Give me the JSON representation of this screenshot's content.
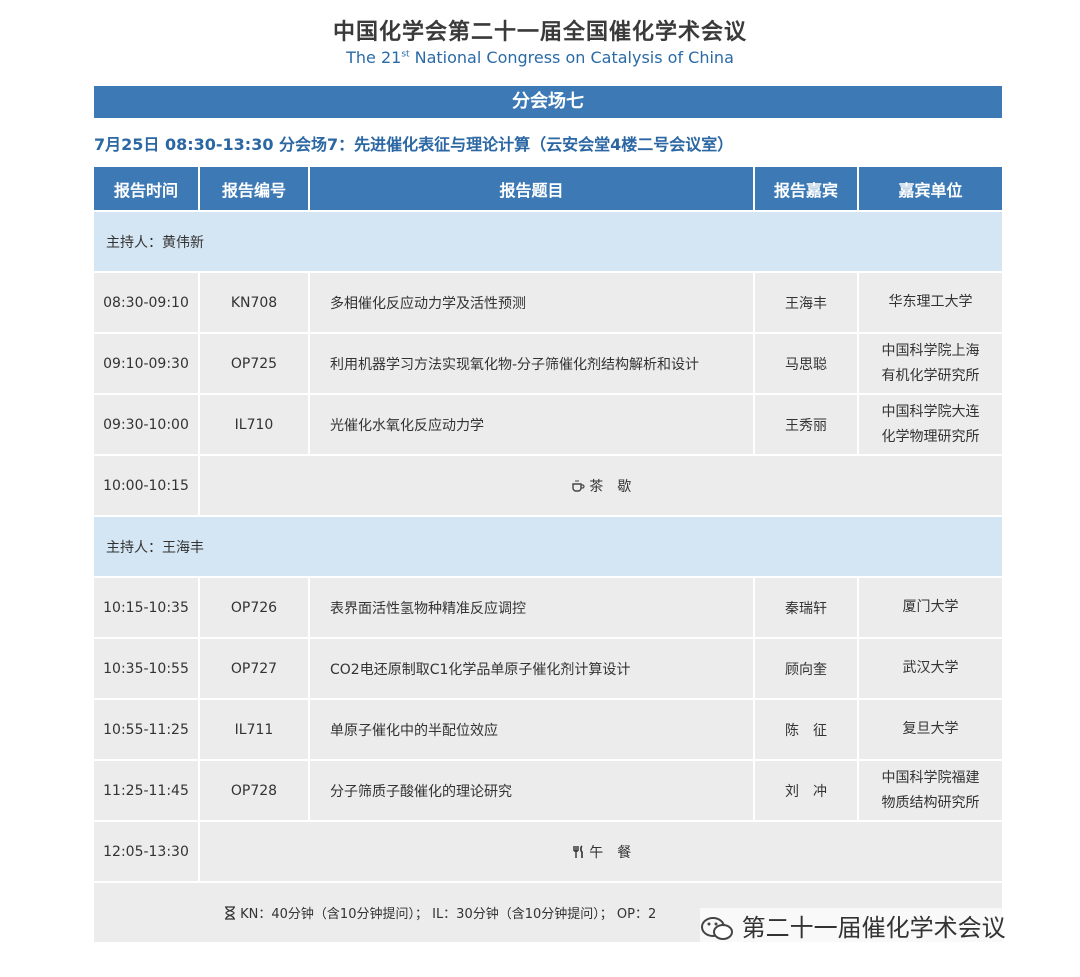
{
  "header": {
    "title_cn": "中国化学会第二十一届全国催化学术会议",
    "title_en_pre": "The 21",
    "title_en_sup": "st",
    "title_en_post": " National Congress on Catalysis of China"
  },
  "banner": "分会场七",
  "session_info": "7月25日 08:30-13:30 分会场7：先进催化表征与理论计算（云安会堂4楼二号会议室）",
  "table": {
    "headers": [
      "报告时间",
      "报告编号",
      "报告题目",
      "报告嘉宾",
      "嘉宾单位"
    ],
    "host1": "主持人：黄伟新",
    "rows1": [
      {
        "time": "08:30-09:10",
        "code": "KN708",
        "topic": "多相催化反应动力学及活性预测",
        "speaker": "王海丰",
        "unit1": "华东理工大学",
        "unit2": ""
      },
      {
        "time": "09:10-09:30",
        "code": "OP725",
        "topic": "利用机器学习方法实现氧化物-分子筛催化剂结构解析和设计",
        "speaker": "马思聪",
        "unit1": "中国科学院上海",
        "unit2": "有机化学研究所"
      },
      {
        "time": "09:30-10:00",
        "code": "IL710",
        "topic": "光催化水氧化反应动力学",
        "speaker": "王秀丽",
        "unit1": "中国科学院大连",
        "unit2": "化学物理研究所"
      }
    ],
    "break": {
      "time": "10:00-10:15",
      "label": "茶　歇"
    },
    "host2": "主持人：王海丰",
    "rows2": [
      {
        "time": "10:15-10:35",
        "code": "OP726",
        "topic": "表界面活性氢物种精准反应调控",
        "speaker": "秦瑞轩",
        "unit1": "厦门大学",
        "unit2": ""
      },
      {
        "time": "10:35-10:55",
        "code": "OP727",
        "topic": "CO2电还原制取C1化学品单原子催化剂计算设计",
        "speaker": "顾向奎",
        "unit1": "武汉大学",
        "unit2": ""
      },
      {
        "time": "10:55-11:25",
        "code": "IL711",
        "topic": "单原子催化中的半配位效应",
        "speaker": "陈　征",
        "unit1": "复旦大学",
        "unit2": ""
      },
      {
        "time": "11:25-11:45",
        "code": "OP728",
        "topic": "分子筛质子酸催化的理论研究",
        "speaker": "刘　冲",
        "unit1": "中国科学院福建",
        "unit2": "物质结构研究所"
      }
    ],
    "lunch": {
      "time": "12:05-13:30",
      "label": "午　餐"
    },
    "footer": "KN：40分钟（含10分钟提问）； IL：30分钟（含10分钟提问）； OP：2"
  },
  "watermark": "第二十一届催化学术会议",
  "icons": {
    "tea": "tea-cup-icon",
    "lunch": "fork-knife-icon",
    "timer": "hourglass-icon",
    "wechat": "wechat-icon"
  },
  "colors": {
    "header_blue": "#3d7ab5",
    "host_row": "#d4e6f3",
    "cell_gray": "#ececec",
    "session_text": "#2b67a3"
  }
}
